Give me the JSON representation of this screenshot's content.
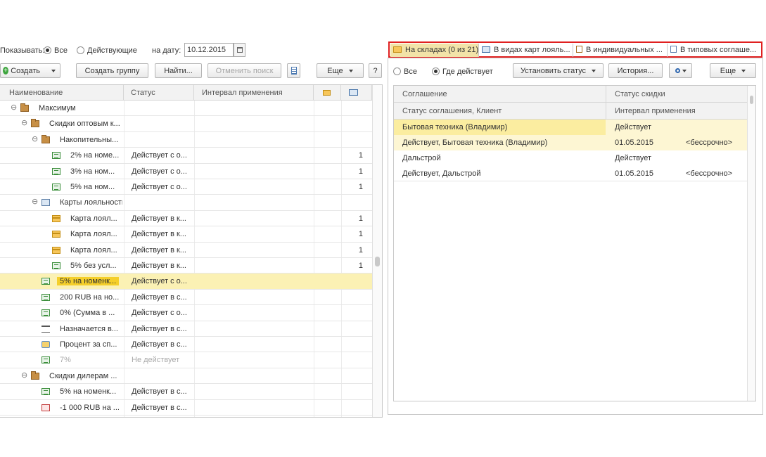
{
  "filter": {
    "show_label": "Показывать:",
    "all_label": "Все",
    "active_label": "Действующие",
    "date_label": "на дату:",
    "date_value": "10.12.2015"
  },
  "toolbar": {
    "create_label": "Создать",
    "create_group_label": "Создать группу",
    "find_label": "Найти...",
    "cancel_search_label": "Отменить поиск",
    "more_label": "Еще",
    "help_label": "?"
  },
  "left_table": {
    "columns": [
      "Наименование",
      "Статус",
      "Интервал применения"
    ],
    "rows": [
      {
        "name": "Максимум",
        "status": "",
        "count": "",
        "icon": "folder-icon",
        "level": 0,
        "expander": "⊖"
      },
      {
        "name": "Скидки оптовым к...",
        "status": "",
        "count": "",
        "icon": "folder-icon",
        "level": 1,
        "expander": "⊖"
      },
      {
        "name": "Накопительны...",
        "status": "",
        "count": "",
        "icon": "folder-icon",
        "level": 2,
        "expander": "⊖"
      },
      {
        "name": "2% на номе...",
        "status": "Действует с о...",
        "count": "1",
        "icon": "money-icon",
        "level": 3,
        "expander": ""
      },
      {
        "name": "3% на ном...",
        "status": "Действует с о...",
        "count": "1",
        "icon": "money-icon",
        "level": 3,
        "expander": ""
      },
      {
        "name": "5% на ном...",
        "status": "Действует с о...",
        "count": "1",
        "icon": "money-icon",
        "level": 3,
        "expander": ""
      },
      {
        "name": "Карты лояльности",
        "status": "",
        "count": "",
        "icon": "cards-folder-icon",
        "level": 2,
        "expander": "⊖"
      },
      {
        "name": "Карта лоял...",
        "status": "Действует в к...",
        "count": "1",
        "icon": "card-icon",
        "level": 3,
        "expander": ""
      },
      {
        "name": "Карта лоял...",
        "status": "Действует в к...",
        "count": "1",
        "icon": "card-icon",
        "level": 3,
        "expander": ""
      },
      {
        "name": "Карта лоял...",
        "status": "Действует в к...",
        "count": "1",
        "icon": "card-icon",
        "level": 3,
        "expander": ""
      },
      {
        "name": "5% без усл...",
        "status": "Действует в к...",
        "count": "1",
        "icon": "money-icon",
        "level": 3,
        "expander": ""
      },
      {
        "name": "5% на номенк...",
        "status": "Действует с о...",
        "count": "",
        "icon": "money-icon",
        "level": 2,
        "expander": "",
        "selected": true
      },
      {
        "name": "200 RUB на но...",
        "status": "Действует в с...",
        "count": "",
        "icon": "money-icon",
        "level": 2,
        "expander": ""
      },
      {
        "name": "0% (Сумма в ...",
        "status": "Действует с о...",
        "count": "",
        "icon": "money-icon",
        "level": 2,
        "expander": ""
      },
      {
        "name": "Назначается в...",
        "status": "Действует в с...",
        "count": "",
        "icon": "bars-icon",
        "level": 2,
        "expander": ""
      },
      {
        "name": "Процент за сп...",
        "status": "Действует в с...",
        "count": "",
        "icon": "percent-icon",
        "level": 2,
        "expander": ""
      },
      {
        "name": "7%",
        "status": "Не действует",
        "count": "",
        "icon": "money-icon",
        "level": 2,
        "expander": "",
        "inactive": true
      },
      {
        "name": "Скидки дилерам ...",
        "status": "",
        "count": "",
        "icon": "folder-icon",
        "level": 1,
        "expander": "⊖"
      },
      {
        "name": "5% на номенк...",
        "status": "Действует в с...",
        "count": "",
        "icon": "money-icon",
        "level": 2,
        "expander": ""
      },
      {
        "name": "-1 000 RUB на ...",
        "status": "Действует в с...",
        "count": "",
        "icon": "minus-money-icon",
        "level": 2,
        "expander": ""
      }
    ]
  },
  "tabs": [
    {
      "label": "На складах (0 из 21)",
      "icon": "warehouse-icon",
      "active": true
    },
    {
      "label": "В видах карт лояль...",
      "icon": "cards-icon"
    },
    {
      "label": "В индивидуальных ...",
      "icon": "individual-agreement-icon"
    },
    {
      "label": "В типовых соглаше...",
      "icon": "document-icon"
    }
  ],
  "right_filter": {
    "all_label": "Все",
    "where_active_label": "Где действует"
  },
  "right_toolbar": {
    "set_status_label": "Установить статус",
    "history_label": "История...",
    "more_label": "Еще"
  },
  "right_table": {
    "header1": [
      "Соглашение",
      "Статус скидки"
    ],
    "header2": [
      "Статус соглашения, Клиент",
      "Интервал применения"
    ],
    "groups": [
      {
        "agreement": "Бытовая техника (Владимир)",
        "discount_status": "Действует",
        "detail": "Действует, Бытовая техника (Владимир)",
        "date": "01.05.2015",
        "interval": "<бессрочно>",
        "selected": true
      },
      {
        "agreement": "Дальстрой",
        "discount_status": "Действует",
        "detail": "Действует, Дальстрой",
        "date": "01.05.2015",
        "interval": "<бессрочно>"
      }
    ]
  },
  "colors": {
    "selection": "#fbf1b4",
    "selection_strong": "#f5cf2a",
    "highlight_border": "#e02020"
  }
}
